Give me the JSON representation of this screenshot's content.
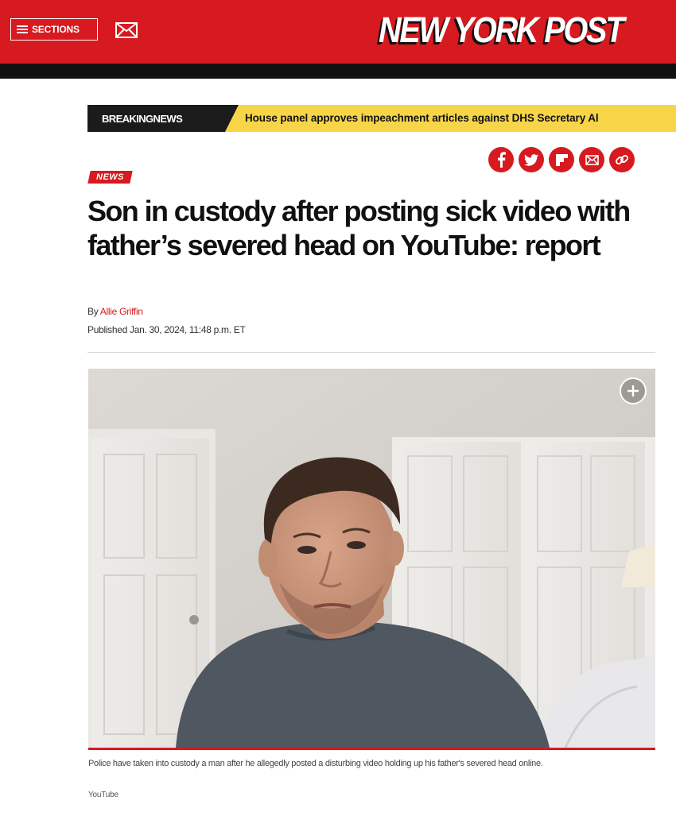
{
  "header": {
    "sections_label": "SECTIONS",
    "logo_text": "NEW YORK POST",
    "colors": {
      "brand_red": "#d71920",
      "band_black": "#111111"
    }
  },
  "breaking": {
    "label": "BREAKINGNEWS",
    "headline": "House panel approves impeachment articles against DHS Secretary Al",
    "color": "#f7d548"
  },
  "share": {
    "icons": [
      "facebook-icon",
      "twitter-icon",
      "flipboard-icon",
      "email-icon",
      "link-icon"
    ]
  },
  "article": {
    "kicker": "NEWS",
    "headline": "Son in custody after posting sick video with father’s severed head on YouTube: report",
    "byline_prefix": "By",
    "author": "Allie Griffin",
    "published": "Published Jan. 30, 2024, 11:48 p.m. ET",
    "photo": {
      "caption": "Police have taken into custody a man after he allegedly posted a disturbing video holding up his father's severed head online.",
      "credit": "YouTube"
    }
  }
}
